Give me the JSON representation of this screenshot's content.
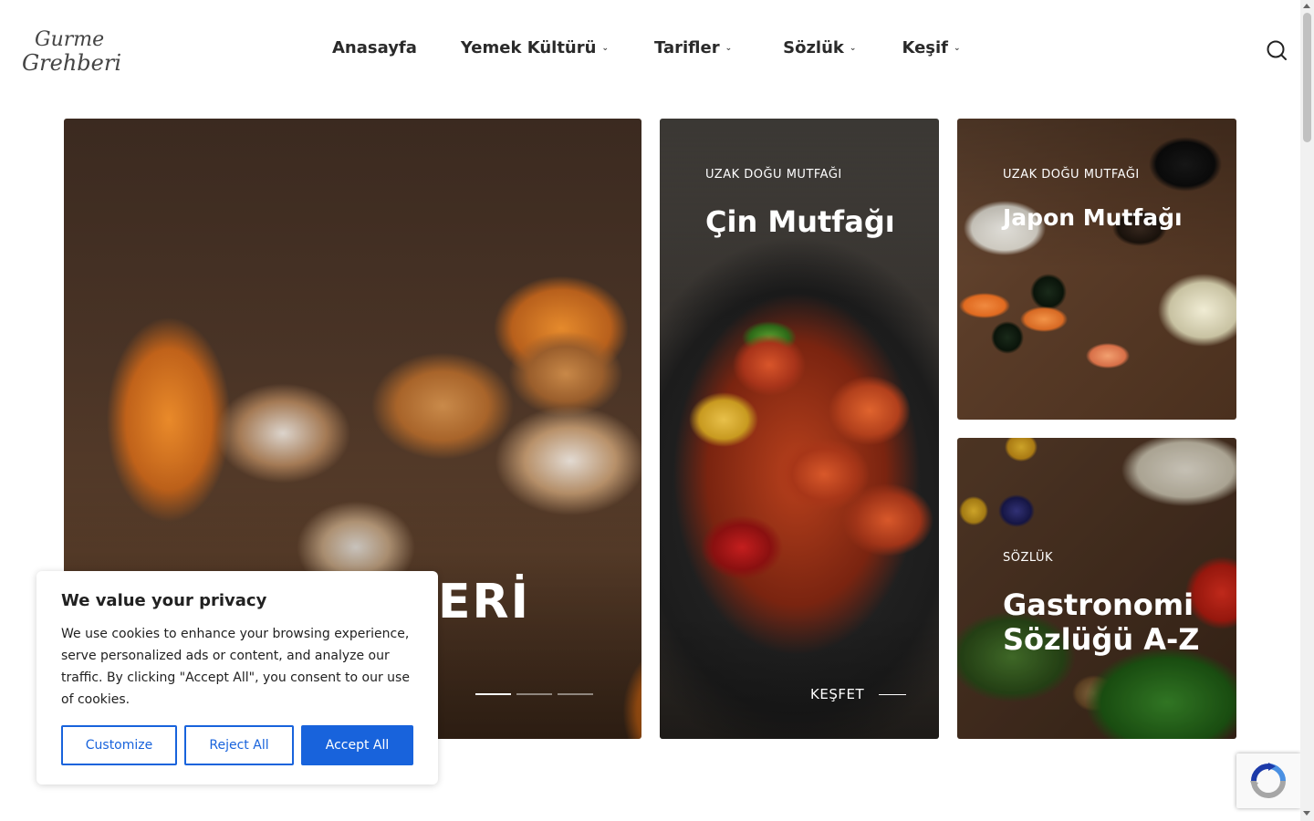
{
  "header": {
    "logo_line1": "Gurme",
    "logo_line2": "Grehberi",
    "nav": [
      {
        "label": "Anasayfa",
        "has_dropdown": false
      },
      {
        "label": "Yemek Kültürü",
        "has_dropdown": true
      },
      {
        "label": "Tarifler",
        "has_dropdown": true
      },
      {
        "label": "Sözlük",
        "has_dropdown": true
      },
      {
        "label": "Keşif",
        "has_dropdown": true
      }
    ],
    "search_icon": "search-icon"
  },
  "hero": {
    "title_visible": "ERİ",
    "slides": 3,
    "active_slide": 1
  },
  "cards": [
    {
      "category": "UZAK DOĞU MUTFAĞI",
      "title": "Çin Mutfağı",
      "cta": "KEŞFET"
    },
    {
      "category": "UZAK DOĞU MUTFAĞI",
      "title": "Japon Mutfağı"
    },
    {
      "category": "SÖZLÜK",
      "title": "Gastronomi Sözlüğü A-Z"
    }
  ],
  "cookie": {
    "title": "We value your privacy",
    "text": "We use cookies to enhance your browsing experience, serve personalized ads or content, and analyze our traffic. By clicking \"Accept All\", you consent to our use of cookies.",
    "customize": "Customize",
    "reject": "Reject All",
    "accept": "Accept All"
  },
  "colors": {
    "accent": "#1863dc",
    "text": "#212121"
  }
}
